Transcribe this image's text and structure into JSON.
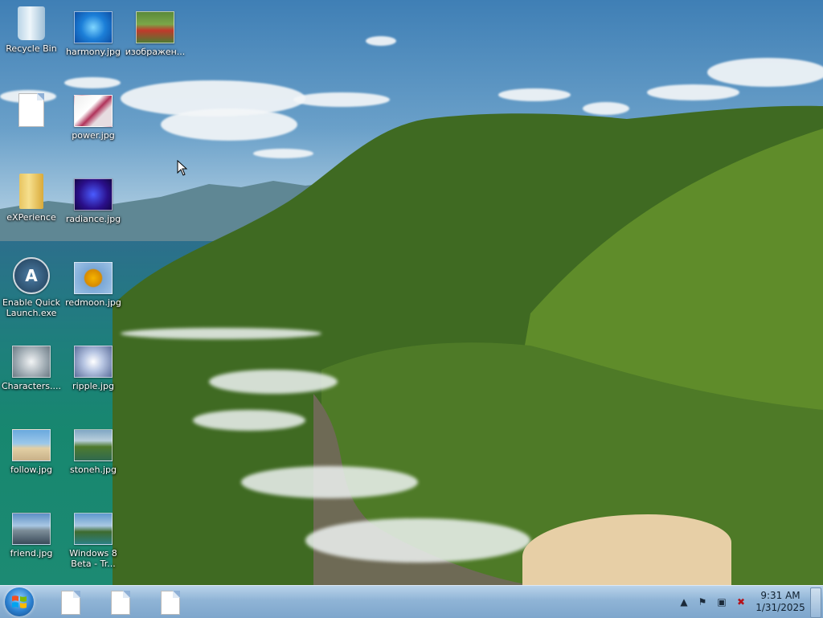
{
  "desktop": {
    "icons": [
      {
        "label": "Recycle Bin",
        "icon": "recycle-bin-icon"
      },
      {
        "label": "harmony.jpg",
        "icon": "image-file-icon"
      },
      {
        "label": "изображен...",
        "icon": "image-file-icon"
      },
      {
        "label": "",
        "icon": "document-file-icon"
      },
      {
        "label": "power.jpg",
        "icon": "image-file-icon"
      },
      {
        "label": "eXPerience",
        "icon": "folder-icon"
      },
      {
        "label": "radiance.jpg",
        "icon": "image-file-icon"
      },
      {
        "label": "Enable Quick Launch.exe",
        "icon": "application-icon"
      },
      {
        "label": "redmoon.jpg",
        "icon": "image-file-icon"
      },
      {
        "label": "Characters....",
        "icon": "image-file-icon"
      },
      {
        "label": "ripple.jpg",
        "icon": "image-file-icon"
      },
      {
        "label": "follow.jpg",
        "icon": "image-file-icon"
      },
      {
        "label": "stoneh.jpg",
        "icon": "image-file-icon"
      },
      {
        "label": "friend.jpg",
        "icon": "image-file-icon"
      },
      {
        "label": "Windows 8 Beta - Tr...",
        "icon": "image-file-icon"
      }
    ]
  },
  "taskbar": {
    "start_icon": "windows-logo-icon",
    "pinned": [
      "document-file-icon",
      "document-file-icon",
      "document-file-icon"
    ],
    "tray": {
      "icons": [
        "chevron-up-icon",
        "flag-icon",
        "network-icon",
        "speaker-muted-icon"
      ],
      "time": "9:31 AM",
      "date": "1/31/2025"
    }
  },
  "colors": {
    "taskbar": "#8fb4d6",
    "icon_label": "#ffffff"
  }
}
